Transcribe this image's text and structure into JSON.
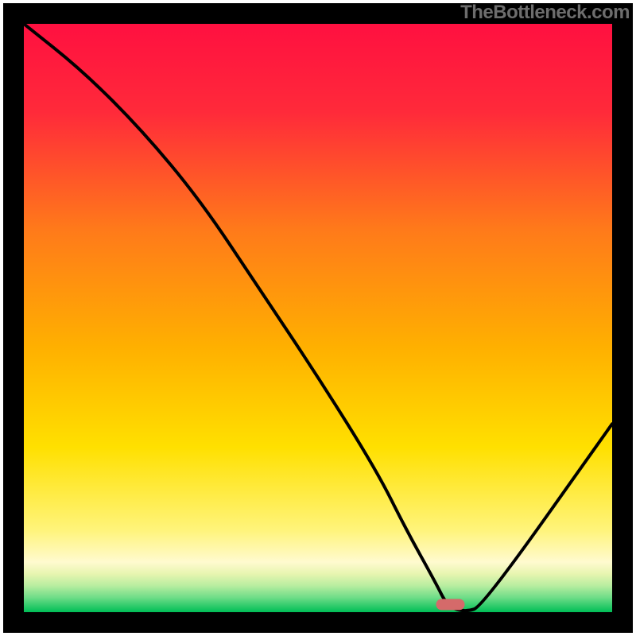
{
  "watermark": "TheBottleneck.com",
  "chart_data": {
    "type": "line",
    "title": "",
    "xlabel": "",
    "ylabel": "",
    "xlim": [
      0,
      100
    ],
    "ylim": [
      0,
      100
    ],
    "series": [
      {
        "name": "curve",
        "x": [
          0,
          10,
          20,
          30,
          40,
          50,
          60,
          65,
          70,
          72,
          75,
          78,
          100
        ],
        "y": [
          100,
          92,
          82,
          70,
          55,
          40,
          24,
          14,
          5,
          1,
          0,
          1,
          32
        ]
      }
    ],
    "marker": {
      "x": 72.5,
      "y": 1.3
    },
    "colors": {
      "gradient_top": "#ff0a3a",
      "gradient_mid_orange": "#ff8a00",
      "gradient_mid_yellow": "#ffe500",
      "gradient_low_cream": "#fbf6c4",
      "gradient_green_light": "#7fe88d",
      "gradient_green": "#00c853",
      "curve": "#000000",
      "marker_fill": "#d56a6a"
    }
  }
}
